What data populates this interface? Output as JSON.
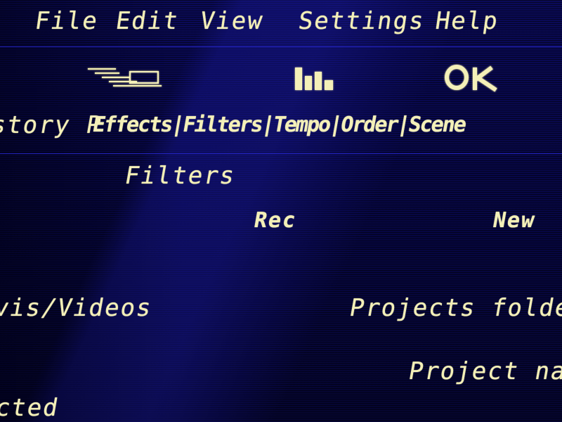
{
  "menu": {
    "file": "File",
    "edit": "Edit",
    "view": "View",
    "settings": "Settings",
    "help": "Help"
  },
  "toolbar": {
    "icons": [
      "list-icon",
      "chart-icon",
      "ok-icon"
    ],
    "text_strip": "story P",
    "overlapped": "Effects|Filters|Tempo|Order|Scene",
    "ok_label": "OK"
  },
  "filter_row": {
    "label": "Filters"
  },
  "actions": {
    "record": "Rec",
    "new": "New"
  },
  "paths": {
    "videos": "vis/Videos",
    "projects_folder": "Projects folder",
    "project_name": "Project name",
    "selected": "cted"
  },
  "colors": {
    "background": "#06063a",
    "text": "#f4f0b8",
    "accent_line": "#2a2ad8"
  }
}
